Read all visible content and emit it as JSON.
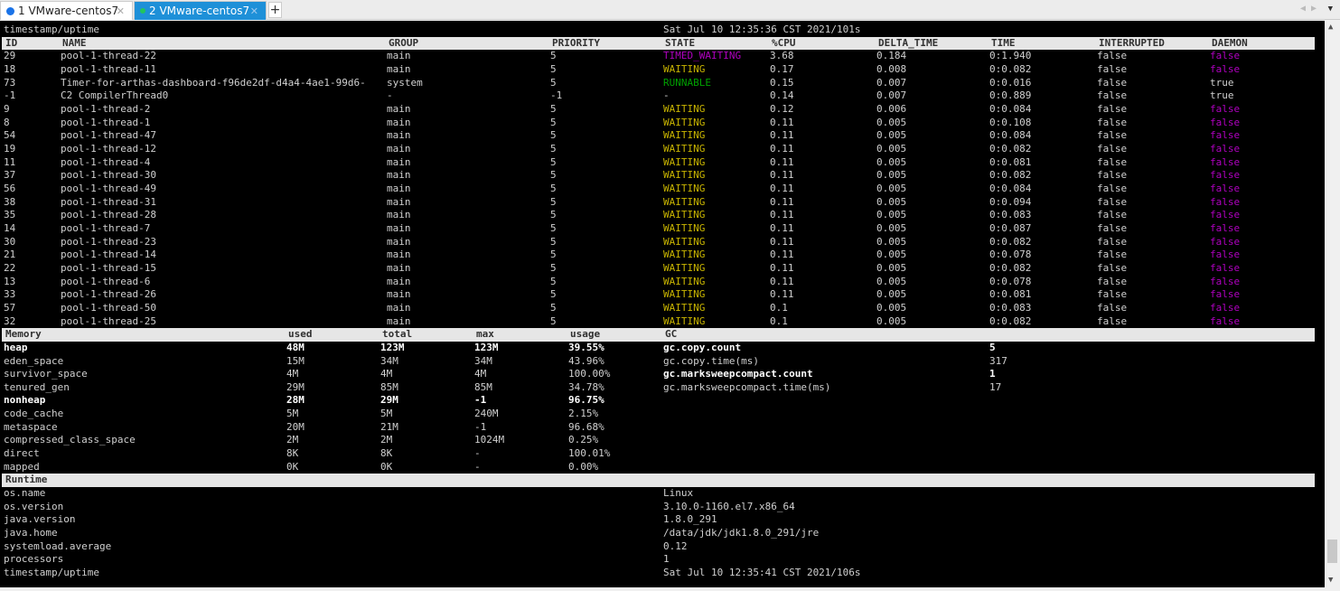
{
  "tabs": [
    {
      "label": "1 VMware-centos7",
      "status_color": "#1a73e8",
      "active": false
    },
    {
      "label": "2 VMware-centos7",
      "status_color": "#22c55e",
      "active": true
    }
  ],
  "colors": {
    "WAITING": "#c8b400",
    "TIMED_WAITING": "#b000c0",
    "RUNNABLE": "#00a000",
    "daemon_false": "#b000c0"
  },
  "top_timestamp": {
    "label": "timestamp/uptime",
    "value": "Sat Jul 10 12:35:36 CST 2021/101s"
  },
  "threads": {
    "columns": [
      "ID",
      "NAME",
      "GROUP",
      "PRIORITY",
      "STATE",
      "%CPU",
      "DELTA_TIME",
      "TIME",
      "INTERRUPTED",
      "DAEMON"
    ],
    "rows": [
      [
        "29",
        "pool-1-thread-22",
        "main",
        "5",
        "TIMED_WAITING",
        "3.68",
        "0.184",
        "0:1.940",
        "false",
        "false"
      ],
      [
        "18",
        "pool-1-thread-11",
        "main",
        "5",
        "WAITING",
        "0.17",
        "0.008",
        "0:0.082",
        "false",
        "false"
      ],
      [
        "73",
        "Timer-for-arthas-dashboard-f96de2df-d4a4-4ae1-99d6-",
        "system",
        "5",
        "RUNNABLE",
        "0.15",
        "0.007",
        "0:0.016",
        "false",
        "true"
      ],
      [
        "-1",
        "C2 CompilerThread0",
        "-",
        "-1",
        "-",
        "0.14",
        "0.007",
        "0:0.889",
        "false",
        "true"
      ],
      [
        "9",
        "pool-1-thread-2",
        "main",
        "5",
        "WAITING",
        "0.12",
        "0.006",
        "0:0.084",
        "false",
        "false"
      ],
      [
        "8",
        "pool-1-thread-1",
        "main",
        "5",
        "WAITING",
        "0.11",
        "0.005",
        "0:0.108",
        "false",
        "false"
      ],
      [
        "54",
        "pool-1-thread-47",
        "main",
        "5",
        "WAITING",
        "0.11",
        "0.005",
        "0:0.084",
        "false",
        "false"
      ],
      [
        "19",
        "pool-1-thread-12",
        "main",
        "5",
        "WAITING",
        "0.11",
        "0.005",
        "0:0.082",
        "false",
        "false"
      ],
      [
        "11",
        "pool-1-thread-4",
        "main",
        "5",
        "WAITING",
        "0.11",
        "0.005",
        "0:0.081",
        "false",
        "false"
      ],
      [
        "37",
        "pool-1-thread-30",
        "main",
        "5",
        "WAITING",
        "0.11",
        "0.005",
        "0:0.082",
        "false",
        "false"
      ],
      [
        "56",
        "pool-1-thread-49",
        "main",
        "5",
        "WAITING",
        "0.11",
        "0.005",
        "0:0.084",
        "false",
        "false"
      ],
      [
        "38",
        "pool-1-thread-31",
        "main",
        "5",
        "WAITING",
        "0.11",
        "0.005",
        "0:0.094",
        "false",
        "false"
      ],
      [
        "35",
        "pool-1-thread-28",
        "main",
        "5",
        "WAITING",
        "0.11",
        "0.005",
        "0:0.083",
        "false",
        "false"
      ],
      [
        "14",
        "pool-1-thread-7",
        "main",
        "5",
        "WAITING",
        "0.11",
        "0.005",
        "0:0.087",
        "false",
        "false"
      ],
      [
        "30",
        "pool-1-thread-23",
        "main",
        "5",
        "WAITING",
        "0.11",
        "0.005",
        "0:0.082",
        "false",
        "false"
      ],
      [
        "21",
        "pool-1-thread-14",
        "main",
        "5",
        "WAITING",
        "0.11",
        "0.005",
        "0:0.078",
        "false",
        "false"
      ],
      [
        "22",
        "pool-1-thread-15",
        "main",
        "5",
        "WAITING",
        "0.11",
        "0.005",
        "0:0.082",
        "false",
        "false"
      ],
      [
        "13",
        "pool-1-thread-6",
        "main",
        "5",
        "WAITING",
        "0.11",
        "0.005",
        "0:0.078",
        "false",
        "false"
      ],
      [
        "33",
        "pool-1-thread-26",
        "main",
        "5",
        "WAITING",
        "0.11",
        "0.005",
        "0:0.081",
        "false",
        "false"
      ],
      [
        "57",
        "pool-1-thread-50",
        "main",
        "5",
        "WAITING",
        "0.1",
        "0.005",
        "0:0.083",
        "false",
        "false"
      ],
      [
        "32",
        "pool-1-thread-25",
        "main",
        "5",
        "WAITING",
        "0.1",
        "0.005",
        "0:0.082",
        "false",
        "false"
      ]
    ]
  },
  "memory": {
    "columns": [
      "Memory",
      "used",
      "total",
      "max",
      "usage",
      "GC",
      ""
    ],
    "rows": [
      {
        "bold": true,
        "cells": [
          "heap",
          "48M",
          "123M",
          "123M",
          "39.55%"
        ]
      },
      {
        "bold": false,
        "cells": [
          "eden_space",
          "15M",
          "34M",
          "34M",
          "43.96%"
        ]
      },
      {
        "bold": false,
        "cells": [
          "survivor_space",
          "4M",
          "4M",
          "4M",
          "100.00%"
        ]
      },
      {
        "bold": false,
        "cells": [
          "tenured_gen",
          "29M",
          "85M",
          "85M",
          "34.78%"
        ]
      },
      {
        "bold": true,
        "cells": [
          "nonheap",
          "28M",
          "29M",
          "-1",
          "96.75%"
        ]
      },
      {
        "bold": false,
        "cells": [
          "code_cache",
          "5M",
          "5M",
          "240M",
          "2.15%"
        ]
      },
      {
        "bold": false,
        "cells": [
          "metaspace",
          "20M",
          "21M",
          "-1",
          "96.68%"
        ]
      },
      {
        "bold": false,
        "cells": [
          "compressed_class_space",
          "2M",
          "2M",
          "1024M",
          "0.25%"
        ]
      },
      {
        "bold": false,
        "cells": [
          "direct",
          "8K",
          "8K",
          "-",
          "100.01%"
        ]
      },
      {
        "bold": false,
        "cells": [
          "mapped",
          "0K",
          "0K",
          "-",
          "0.00%"
        ]
      }
    ],
    "gc": [
      {
        "bold": true,
        "cells": [
          "gc.copy.count",
          "5"
        ]
      },
      {
        "bold": false,
        "cells": [
          "gc.copy.time(ms)",
          "317"
        ]
      },
      {
        "bold": true,
        "cells": [
          "gc.marksweepcompact.count",
          "1"
        ]
      },
      {
        "bold": false,
        "cells": [
          "gc.marksweepcompact.time(ms)",
          "17"
        ]
      }
    ]
  },
  "runtime": {
    "title": "Runtime",
    "rows": [
      [
        "os.name",
        "Linux"
      ],
      [
        "os.version",
        "3.10.0-1160.el7.x86_64"
      ],
      [
        "java.version",
        "1.8.0_291"
      ],
      [
        "java.home",
        "/data/jdk/jdk1.8.0_291/jre"
      ],
      [
        "systemload.average",
        "0.12"
      ],
      [
        "processors",
        "1"
      ],
      [
        "timestamp/uptime",
        "Sat Jul 10 12:35:41 CST 2021/106s"
      ]
    ]
  }
}
